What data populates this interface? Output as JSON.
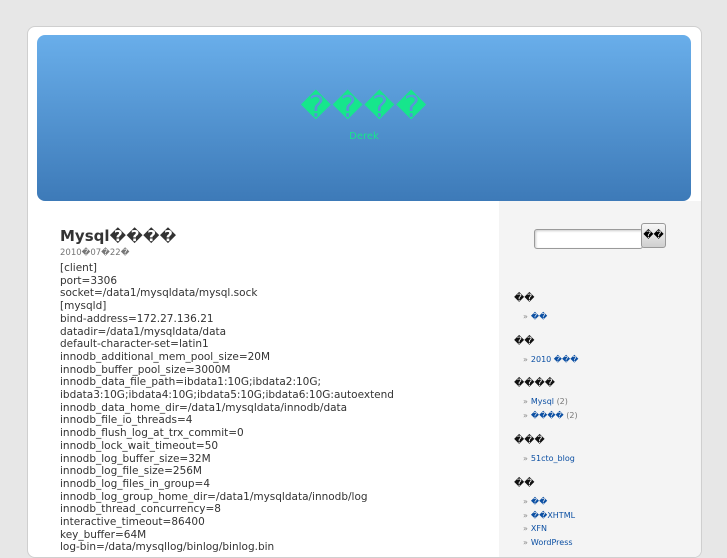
{
  "header": {
    "title": "����",
    "description": "Derek"
  },
  "post": {
    "title": "Mysql����",
    "date": "2010�07�22�",
    "lines": [
      "[client]",
      "port=3306",
      "socket=/data1/mysqldata/mysql.sock",
      "[mysqld]",
      "bind-address=172.27.136.21",
      "datadir=/data1/mysqldata/data",
      "default-character-set=latin1",
      "innodb_additional_mem_pool_size=20M",
      "innodb_buffer_pool_size=3000M",
      "innodb_data_file_path=ibdata1:10G;ibdata2:10G;",
      "ibdata3:10G;ibdata4:10G;ibdata5:10G;ibdata6:10G:autoextend",
      "innodb_data_home_dir=/data1/mysqldata/innodb/data",
      "innodb_file_io_threads=4",
      "innodb_flush_log_at_trx_commit=0",
      "innodb_lock_wait_timeout=50",
      "innodb_log_buffer_size=32M",
      "innodb_log_file_size=256M",
      "innodb_log_files_in_group=4",
      "innodb_log_group_home_dir=/data1/mysqldata/innodb/log",
      "innodb_thread_concurrency=8",
      "interactive_timeout=86400",
      "key_buffer=64M",
      "log-bin=/data/mysqllog/binlog/binlog.bin"
    ]
  },
  "sidebar": {
    "search": {
      "value": "",
      "button_label": "��"
    },
    "widgets": [
      {
        "title": "��",
        "items": [
          {
            "label": "��",
            "count": ""
          }
        ]
      },
      {
        "title": "��",
        "items": [
          {
            "label": "2010 ���",
            "count": ""
          }
        ]
      },
      {
        "title": "����",
        "items": [
          {
            "label": "Mysql",
            "count": "(2)"
          },
          {
            "label": "����",
            "count": "(2)"
          }
        ]
      },
      {
        "title": "���",
        "items": [
          {
            "label": "51cto_blog",
            "count": ""
          }
        ]
      },
      {
        "title": "��",
        "items": [
          {
            "label": "��",
            "count": ""
          },
          {
            "label": "��XHTML",
            "count": ""
          },
          {
            "label": "XFN",
            "count": ""
          },
          {
            "label": "WordPress",
            "count": ""
          }
        ]
      }
    ]
  },
  "colors": {
    "header_top": "#69aeea",
    "header_bottom": "#3d7ab8",
    "title_text": "#16e68c",
    "link": "#0b4fa3"
  }
}
